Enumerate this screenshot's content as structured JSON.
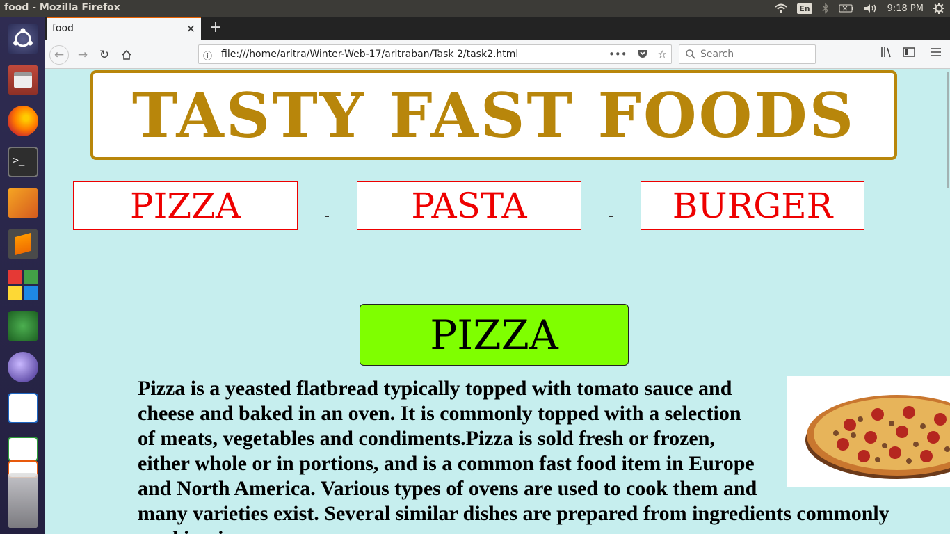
{
  "os": {
    "window_title": "food - Mozilla Firefox",
    "keyboard_layout": "En",
    "clock": "9:18 PM",
    "launcher_icons": [
      "ubuntu-dash-icon",
      "files-icon",
      "firefox-icon",
      "terminal-icon",
      "pycharm-icon",
      "sublime-text-icon",
      "app-grid-icon",
      "android-studio-icon",
      "eclipse-icon",
      "writer-icon",
      "calc-icon",
      "impress-icon",
      "software-center-icon"
    ]
  },
  "browser": {
    "tab_title": "food",
    "url": "file:///home/aritra/Winter-Web-17/aritraban/Task 2/task2.html",
    "search_placeholder": "Search"
  },
  "page": {
    "banner_title": "TASTY FAST FOODS",
    "nav": [
      "PIZZA",
      "PASTA",
      "BURGER"
    ],
    "section_heading": "PIZZA",
    "paragraph": "Pizza is a yeasted flatbread typically topped with tomato sauce and cheese and baked in an oven. It is commonly topped with a selection of meats, vegetables and condiments.Pizza is sold fresh or frozen, either whole or in portions, and is a common fast food item in Europe and North America. Various types of ovens are used to cook them and many varieties exist. Several similar dishes are prepared from ingredients commonly used in pizza",
    "colors": {
      "banner": "#b8860b",
      "nav_text": "#e00000",
      "section_bg": "#7fff00",
      "page_bg": "#c6eeee"
    }
  }
}
